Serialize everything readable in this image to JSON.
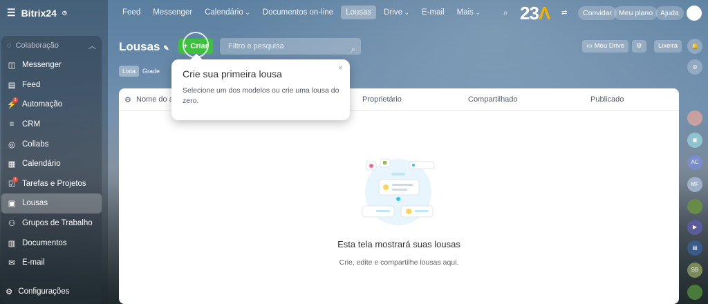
{
  "app": {
    "name": "Bitrix24"
  },
  "sidebar": {
    "section": "Colaboração",
    "items": [
      {
        "label": "Messenger",
        "icon": "chat-icon"
      },
      {
        "label": "Feed",
        "icon": "feed-icon"
      },
      {
        "label": "Automação",
        "icon": "automation-icon",
        "badge": "1"
      },
      {
        "label": "CRM",
        "icon": "crm-icon"
      },
      {
        "label": "Collabs",
        "icon": "collabs-icon"
      },
      {
        "label": "Calendário",
        "icon": "calendar-icon"
      },
      {
        "label": "Tarefas e Projetos",
        "icon": "tasks-icon",
        "badge": "1"
      },
      {
        "label": "Lousas",
        "icon": "board-icon",
        "active": true
      },
      {
        "label": "Grupos de Trabalho",
        "icon": "groups-icon"
      },
      {
        "label": "Documentos",
        "icon": "documents-icon"
      },
      {
        "label": "E-mail",
        "icon": "mail-icon"
      }
    ],
    "settings": "Configurações"
  },
  "topnav": {
    "items": [
      "Feed",
      "Messenger",
      "Calendário",
      "Documentos on-line",
      "Lousas",
      "Drive",
      "E-mail",
      "Mais"
    ],
    "active": "Lousas"
  },
  "header": {
    "brand_number": "23",
    "invite": "Convidar",
    "plan": "Meu plano",
    "help": "Ajuda"
  },
  "page": {
    "title": "Lousas",
    "create": "Criar",
    "search_placeholder": "Filtro e pesquisa",
    "my_drive": "Meu Drive",
    "trash": "Lixeira",
    "views": [
      "Lista",
      "Grade"
    ]
  },
  "table": {
    "columns": [
      "Nome do ar",
      "Proprietário",
      "Compartilhado",
      "Publicado"
    ],
    "empty_title": "Esta tela mostrará suas lousas",
    "empty_sub": "Crie, edite e compartilhe lousas aqui."
  },
  "popup": {
    "title": "Crie sua primeira lousa",
    "text": "Selecione um dos modelos ou crie uma lousa do zero."
  },
  "rail": {
    "initials": [
      "AC",
      "MF",
      "SB"
    ]
  },
  "colors": {
    "accent": "#3bc13b",
    "brand_accent": "#f0b400"
  }
}
